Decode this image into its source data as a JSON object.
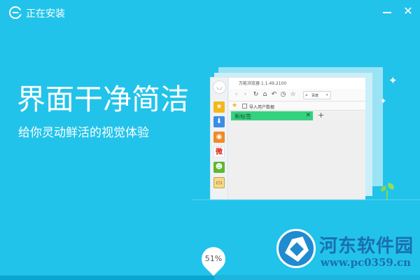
{
  "window": {
    "title": "正在安装",
    "minimize_icon": "minimize-icon",
    "close_icon": "close-icon",
    "close_glyph": "✕"
  },
  "hero": {
    "headline": "界面干净简洁",
    "subline": "给你灵动鲜活的视觉体验"
  },
  "mock_browser": {
    "title": "万能浏览器 1.1.49.2100",
    "sidebar": {
      "avatar_glyph": "◡",
      "icons": [
        "star-icon",
        "download-icon",
        "rss-icon",
        "weibo-icon",
        "chat-icon",
        "note-icon"
      ],
      "glyphs": [
        "★",
        "⬇",
        "◉",
        "微",
        "☻",
        "▭"
      ]
    },
    "toolbar": {
      "glyphs": [
        "‹",
        "›",
        "↻",
        "⌂",
        "↶",
        "◷",
        "☆"
      ],
      "search_engine": "百度",
      "search_glyph": "⌕",
      "caret": "▾"
    },
    "bookmarks": {
      "star_glyph": "★",
      "import_label": "导入用户数据"
    },
    "tabs": [
      {
        "label": "新标签",
        "close": "✕"
      }
    ],
    "new_tab_glyph": "+"
  },
  "decor": {
    "sparkles": [
      "✦",
      "✦"
    ]
  },
  "progress": {
    "percent_text": "51%",
    "value": 0.51
  },
  "watermark": {
    "name": "河东软件园",
    "url": "www.pc0359.cn"
  },
  "colors": {
    "background": "#22c3ea",
    "tab_active": "#34d27f",
    "watermark": "#1a6fb0"
  }
}
